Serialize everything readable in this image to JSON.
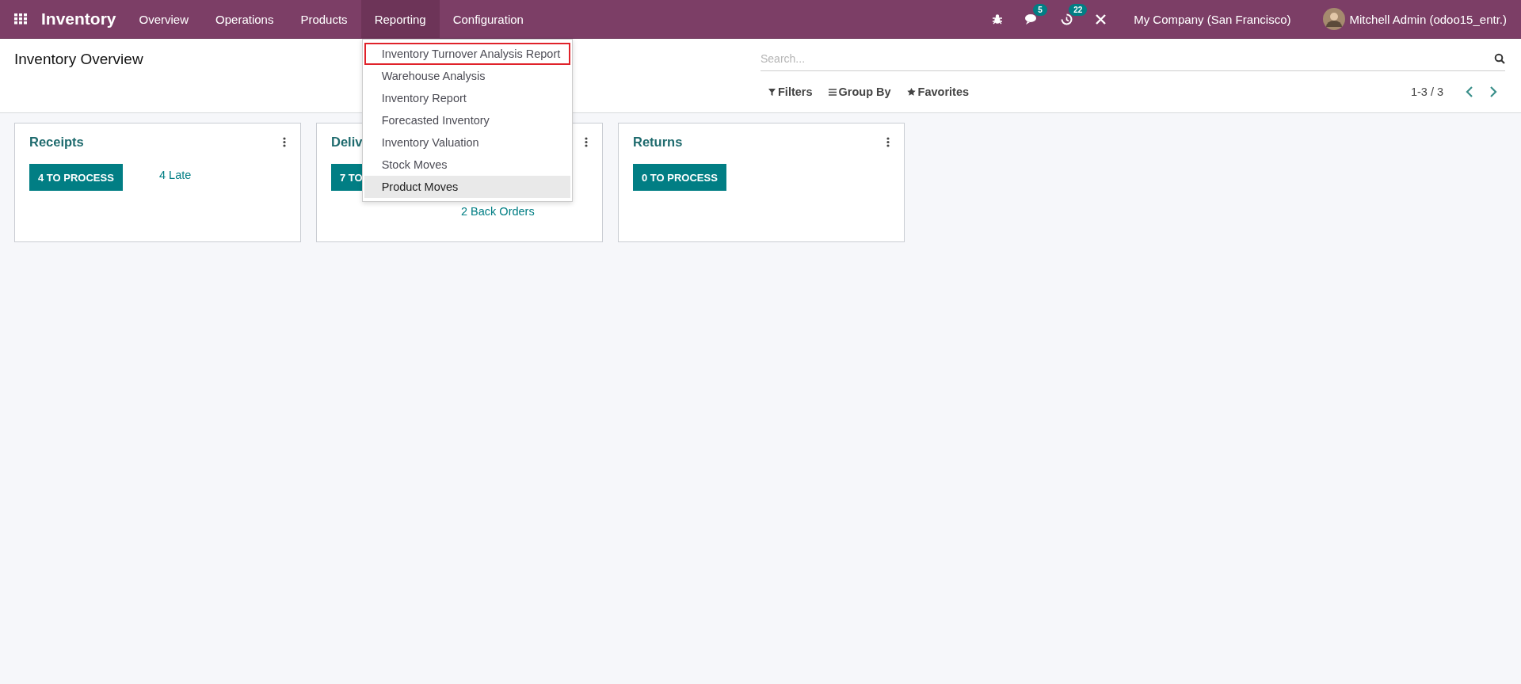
{
  "navbar": {
    "app_name": "Inventory",
    "menus": [
      {
        "label": "Overview",
        "selected": false
      },
      {
        "label": "Operations",
        "selected": false
      },
      {
        "label": "Products",
        "selected": false
      },
      {
        "label": "Reporting",
        "selected": true
      },
      {
        "label": "Configuration",
        "selected": false
      }
    ],
    "messages_badge": "5",
    "activities_badge": "22",
    "company": "My Company (San Francisco)",
    "user": "Mitchell Admin (odoo15_entr.)"
  },
  "reporting_menu": [
    {
      "label": "Inventory Turnover Analysis Report",
      "selected": false,
      "outlined": true
    },
    {
      "label": "Warehouse Analysis",
      "selected": false,
      "outlined": false
    },
    {
      "label": "Inventory Report",
      "selected": false,
      "outlined": false
    },
    {
      "label": "Forecasted Inventory",
      "selected": false,
      "outlined": false
    },
    {
      "label": "Inventory Valuation",
      "selected": false,
      "outlined": false
    },
    {
      "label": "Stock Moves",
      "selected": false,
      "outlined": false
    },
    {
      "label": "Product Moves",
      "selected": true,
      "outlined": false
    }
  ],
  "control_panel": {
    "title": "Inventory Overview",
    "search": {
      "placeholder": "Search..."
    },
    "filters": "Filters",
    "group_by": "Group By",
    "favorites": "Favorites",
    "pager": "1-3 / 3"
  },
  "cards": [
    {
      "title": "Receipts",
      "button": "4 TO PROCESS",
      "links": [
        {
          "text": "4 Late",
          "kind": "late"
        }
      ]
    },
    {
      "title": "Deliv",
      "button": "7 TO",
      "links": [
        {
          "text": "2 Back Orders",
          "kind": "back_orders"
        }
      ]
    },
    {
      "title": "Returns",
      "button": "0 TO PROCESS"
    }
  ]
}
